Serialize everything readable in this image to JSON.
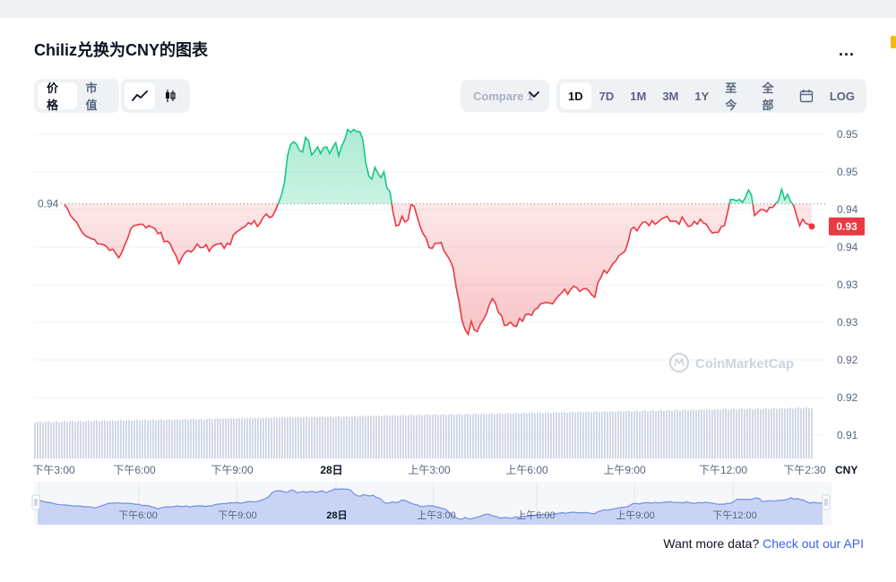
{
  "title": "Chiliz兑换为CNY的图表",
  "more_label": "...",
  "type_toggle": {
    "price_label": "价格",
    "mcap_label": "市值"
  },
  "chart_style": {
    "line_icon": "line-chart-icon",
    "candle_icon": "candlestick-icon"
  },
  "compare": {
    "label": "Compare 1"
  },
  "ranges": [
    "1D",
    "7D",
    "1M",
    "3M",
    "1Y",
    "至今",
    "全部"
  ],
  "range_active": "1D",
  "calendar_icon": "calendar-icon",
  "log_label": "LOG",
  "footer": {
    "prefix": "Want more data?",
    "link": "Check out our API"
  },
  "watermark": "CoinMarketCap",
  "colors": {
    "up": "#16c784",
    "down": "#ea3943",
    "accent": "#3861fb",
    "navigator": "#6e8ee8"
  },
  "chart_data": {
    "type": "line",
    "currency": "CNY",
    "yticks": [
      "0.95",
      "0.95",
      "0.94",
      "0.94",
      "0.93",
      "0.93",
      "0.92",
      "0.92",
      "0.91"
    ],
    "ylim": [
      0.91,
      0.95
    ],
    "baseline": 0.9417,
    "baseline_label": "0.94",
    "last_price_label": "0.93",
    "xticks": [
      {
        "label": "下午3:00",
        "bold": false
      },
      {
        "label": "下午6:00",
        "bold": false
      },
      {
        "label": "下午9:00",
        "bold": false
      },
      {
        "label": "28日",
        "bold": true
      },
      {
        "label": "上午3:00",
        "bold": false
      },
      {
        "label": "上午6:00",
        "bold": false
      },
      {
        "label": "上午9:00",
        "bold": false
      },
      {
        "label": "下午12:00",
        "bold": false
      },
      {
        "label": "下午2:30",
        "bold": false
      }
    ],
    "navigator_ticks": [
      {
        "label": "下午6:00",
        "bold": false
      },
      {
        "label": "下午9:00",
        "bold": false
      },
      {
        "label": "28日",
        "bold": true
      },
      {
        "label": "上午3:00",
        "bold": false
      },
      {
        "label": "上午6:00",
        "bold": false
      },
      {
        "label": "上午9:00",
        "bold": false
      },
      {
        "label": "下午12:00",
        "bold": false
      }
    ],
    "price_series": [
      0.9416,
      0.941,
      0.9401,
      0.9396,
      0.9392,
      0.9384,
      0.9377,
      0.9373,
      0.9371,
      0.9369,
      0.9368,
      0.9362,
      0.9362,
      0.9361,
      0.9358,
      0.9353,
      0.9355,
      0.9349,
      0.9343,
      0.935,
      0.9361,
      0.937,
      0.9383,
      0.9387,
      0.9388,
      0.9389,
      0.9389,
      0.9384,
      0.9387,
      0.9385,
      0.9383,
      0.9376,
      0.9378,
      0.9365,
      0.9366,
      0.9363,
      0.9353,
      0.9346,
      0.9335,
      0.9344,
      0.935,
      0.9353,
      0.9351,
      0.9355,
      0.9362,
      0.9357,
      0.9357,
      0.9361,
      0.9352,
      0.9358,
      0.9361,
      0.9362,
      0.9363,
      0.9356,
      0.9363,
      0.9361,
      0.9374,
      0.9378,
      0.9381,
      0.9384,
      0.9386,
      0.9391,
      0.9389,
      0.9394,
      0.9386,
      0.9391,
      0.9399,
      0.9403,
      0.9398,
      0.94,
      0.9408,
      0.9418,
      0.9429,
      0.9446,
      0.9483,
      0.9498,
      0.9502,
      0.9499,
      0.949,
      0.9488,
      0.9508,
      0.9503,
      0.9484,
      0.9489,
      0.9495,
      0.9486,
      0.9494,
      0.9495,
      0.9486,
      0.9494,
      0.9501,
      0.9483,
      0.9496,
      0.9505,
      0.9519,
      0.9515,
      0.9519,
      0.9516,
      0.9516,
      0.9505,
      0.9473,
      0.9455,
      0.9451,
      0.9467,
      0.9459,
      0.9453,
      0.9461,
      0.9439,
      0.9434,
      0.9406,
      0.9387,
      0.9388,
      0.94,
      0.9392,
      0.9395,
      0.9416,
      0.9414,
      0.94,
      0.9386,
      0.9376,
      0.937,
      0.9357,
      0.9356,
      0.9363,
      0.9363,
      0.9364,
      0.9352,
      0.9346,
      0.9339,
      0.9329,
      0.9302,
      0.9282,
      0.9256,
      0.9244,
      0.9238,
      0.9256,
      0.9244,
      0.9242,
      0.9252,
      0.9258,
      0.9266,
      0.9279,
      0.9287,
      0.9281,
      0.9268,
      0.9264,
      0.925,
      0.9251,
      0.9255,
      0.925,
      0.9249,
      0.926,
      0.9256,
      0.9265,
      0.9266,
      0.9264,
      0.9272,
      0.9274,
      0.928,
      0.9281,
      0.9282,
      0.9281,
      0.928,
      0.9286,
      0.9291,
      0.9295,
      0.93,
      0.9293,
      0.93,
      0.9304,
      0.9302,
      0.9297,
      0.93,
      0.9301,
      0.9298,
      0.9292,
      0.9289,
      0.9309,
      0.9316,
      0.9326,
      0.9322,
      0.9328,
      0.9335,
      0.9339,
      0.9346,
      0.9349,
      0.9352,
      0.9364,
      0.9382,
      0.9385,
      0.938,
      0.9387,
      0.9392,
      0.9392,
      0.9387,
      0.9394,
      0.9389,
      0.9392,
      0.9396,
      0.9398,
      0.94,
      0.9393,
      0.9393,
      0.9393,
      0.9389,
      0.9399,
      0.9392,
      0.9386,
      0.9387,
      0.9393,
      0.9389,
      0.9396,
      0.9391,
      0.9389,
      0.9382,
      0.9377,
      0.9378,
      0.9378,
      0.9386,
      0.9387,
      0.9404,
      0.9423,
      0.9423,
      0.9421,
      0.9423,
      0.9419,
      0.9426,
      0.9436,
      0.9429,
      0.9401,
      0.9405,
      0.9409,
      0.9409,
      0.9406,
      0.9412,
      0.9412,
      0.9417,
      0.9422,
      0.9437,
      0.9423,
      0.943,
      0.942,
      0.9415,
      0.94,
      0.9387,
      0.9396,
      0.939,
      0.9389,
      0.9386
    ],
    "volume_bars": 290
  }
}
